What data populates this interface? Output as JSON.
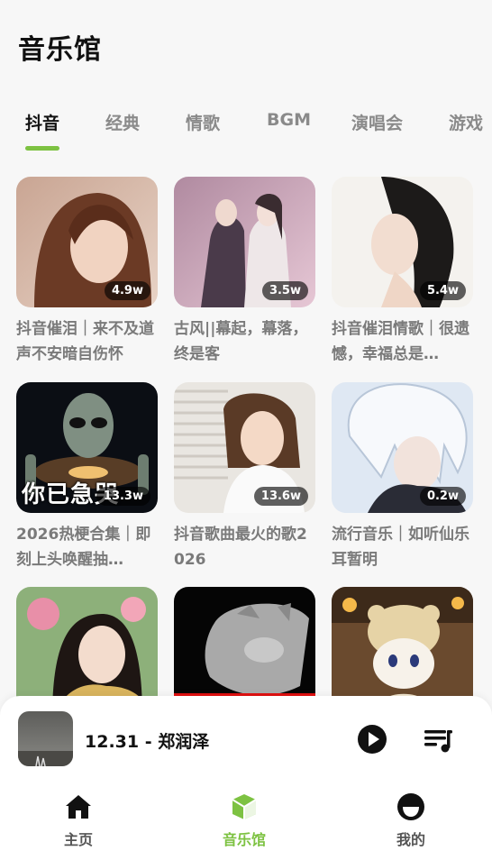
{
  "page_title": "音乐馆",
  "tabs": [
    {
      "label": "抖音",
      "active": true
    },
    {
      "label": "经典",
      "active": false
    },
    {
      "label": "情歌",
      "active": false
    },
    {
      "label": "BGM",
      "active": false
    },
    {
      "label": "演唱会",
      "active": false
    },
    {
      "label": "游戏",
      "active": false
    }
  ],
  "accent_color": "#7dc242",
  "playlists": [
    {
      "count": "4.9w",
      "title": "抖音催泪｜来不及道声不安暗自伤怀"
    },
    {
      "count": "3.5w",
      "title": "古风||幕起，幕落，终是客"
    },
    {
      "count": "5.4w",
      "title": "抖音催泪情歌｜很遗憾，幸福总是…"
    },
    {
      "count": "13.3w",
      "title": "2026热梗合集｜即刻上头唤醒抽…",
      "overlay": "你已急哭"
    },
    {
      "count": "13.6w",
      "title": "抖音歌曲最火的歌2026"
    },
    {
      "count": "0.2w",
      "title": "流行音乐｜如听仙乐耳暂明"
    },
    {
      "count": "",
      "title": ""
    },
    {
      "count": "",
      "title": ""
    },
    {
      "count": "",
      "title": ""
    }
  ],
  "player": {
    "track": "12.31 - 郑润泽",
    "play_icon": "play-icon",
    "queue_icon": "queue-music-icon"
  },
  "nav": [
    {
      "label": "主页",
      "icon": "home-icon",
      "active": false
    },
    {
      "label": "音乐馆",
      "icon": "music-hall-icon",
      "active": true
    },
    {
      "label": "我的",
      "icon": "profile-icon",
      "active": false
    }
  ]
}
